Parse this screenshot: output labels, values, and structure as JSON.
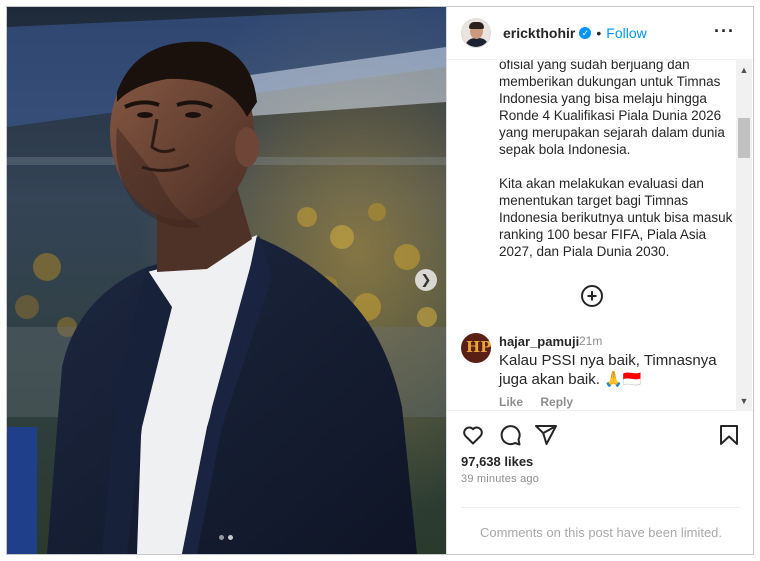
{
  "post": {
    "author": {
      "username": "erickthohir",
      "verified": true,
      "separator": "•",
      "follow_label": "Follow",
      "more_icon": "more-options-icon"
    },
    "caption": {
      "paragraphs": [
        "ofisial yang sudah berjuang dan memberikan dukungan untuk Timnas Indonesia yang bisa melaju hingga Ronde 4 Kualifikasi Piala Dunia 2026 yang merupakan sejarah dalam dunia sepak bola Indonesia.",
        "Kita akan melakukan evaluasi dan menentukan target bagi Timnas Indonesia berikutnya untuk bisa masuk ranking 100 besar FIFA, Piala Asia 2027, dan Piala Dunia 2030."
      ]
    },
    "load_more_icon": "plus-circle-icon",
    "comments": [
      {
        "username": "hajar_pamuji",
        "time": "21m",
        "text": "Kalau PSSI nya baik, Timnasnya juga akan baik. 🙏🇮🇩",
        "avatar_initials": "HP",
        "like_label": "Like",
        "reply_label": "Reply"
      }
    ],
    "likes_text": "97,638 likes",
    "time_ago": "39 minutes ago",
    "comments_limited_text": "Comments on this post have been limited.",
    "photo": {
      "slide_count": 2,
      "active_slide": 2,
      "next_icon": "chevron-right-icon"
    }
  },
  "colors": {
    "accent": "#0095f6",
    "text": "#262626",
    "muted": "#8e8e8e"
  }
}
